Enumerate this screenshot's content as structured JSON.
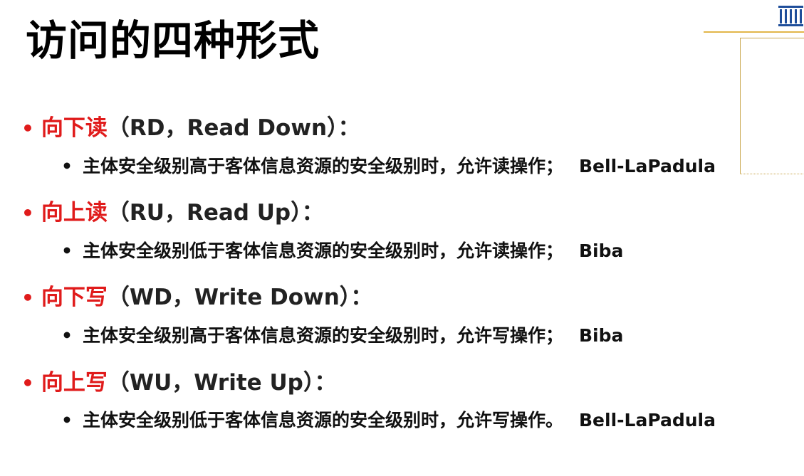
{
  "slide": {
    "title": "访问的四种形式",
    "items": [
      {
        "keyword": "向下读",
        "suffix": "（RD，Read Down）：",
        "description": "主体安全级别高于客体信息资源的安全级别时，允许读操作；",
        "model": "Bell-LaPadula"
      },
      {
        "keyword": "向上读",
        "suffix": "（RU，Read Up）：",
        "description": "主体安全级别低于客体信息资源的安全级别时，允许读操作；",
        "model": "Biba"
      },
      {
        "keyword": "向下写",
        "suffix": "（WD，Write Down）：",
        "description": "主体安全级别高于客体信息资源的安全级别时，允许写操作；",
        "model": "Biba"
      },
      {
        "keyword": "向上写",
        "suffix": "（WU，Write Up）：",
        "description": "主体安全级别低于客体信息资源的安全级别时，允许写操作。",
        "model": "Bell-LaPadula"
      }
    ],
    "logo_icon": "university-building-icon",
    "colors": {
      "keyword": "#e01b1b",
      "accent": "#e2b64a",
      "logo": "#1f4e9a"
    }
  }
}
